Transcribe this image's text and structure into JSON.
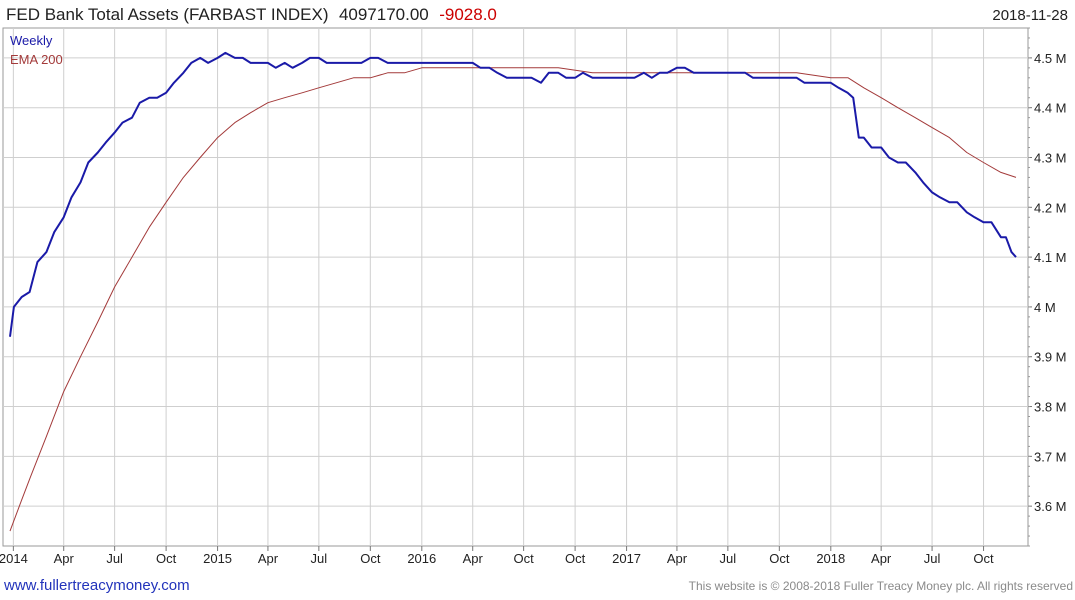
{
  "header": {
    "title": "FED Bank Total Assets (FARBAST INDEX)",
    "last_value": "4097170.00",
    "change": "-9028.0",
    "date": "2018-11-28"
  },
  "legend": {
    "weekly": "Weekly",
    "ema": "EMA 200"
  },
  "footer": {
    "website": "www.fullertreacymoney.com",
    "copyright": "This website is © 2008-2018 Fuller Treacy Money plc. All rights reserved"
  },
  "colors": {
    "weekly": "#1a1aa8",
    "ema": "#a33a3a",
    "grid": "#cfcfcf",
    "change": "#cc0000"
  },
  "chart_data": {
    "type": "line",
    "title": "FED Bank Total Assets (FARBAST INDEX)",
    "xlabel": "",
    "ylabel": "",
    "x_range": [
      "2013-12-26",
      "2018-11-28"
    ],
    "ylim": [
      3.52,
      4.56
    ],
    "y_unit": "M",
    "y_axis_side": "right",
    "grid": true,
    "legend_position": "top-left",
    "y_ticks": [
      {
        "value": 3.6,
        "label": "3.6 M"
      },
      {
        "value": 3.7,
        "label": "3.7 M"
      },
      {
        "value": 3.8,
        "label": "3.8 M"
      },
      {
        "value": 3.9,
        "label": "3.9 M"
      },
      {
        "value": 4.0,
        "label": "4 M"
      },
      {
        "value": 4.1,
        "label": "4.1 M"
      },
      {
        "value": 4.2,
        "label": "4.2 M"
      },
      {
        "value": 4.3,
        "label": "4.3 M"
      },
      {
        "value": 4.4,
        "label": "4.4 M"
      },
      {
        "value": 4.5,
        "label": "4.5 M"
      }
    ],
    "x_ticks": [
      {
        "date": "2014-01-01",
        "label": "2014"
      },
      {
        "date": "2014-04-01",
        "label": "Apr"
      },
      {
        "date": "2014-07-01",
        "label": "Jul"
      },
      {
        "date": "2014-10-01",
        "label": "Oct"
      },
      {
        "date": "2015-01-01",
        "label": "2015"
      },
      {
        "date": "2015-04-01",
        "label": "Apr"
      },
      {
        "date": "2015-07-01",
        "label": "Jul"
      },
      {
        "date": "2015-10-01",
        "label": "Oct"
      },
      {
        "date": "2016-01-01",
        "label": "2016"
      },
      {
        "date": "2016-04-01",
        "label": "Apr"
      },
      {
        "date": "2016-07-01",
        "label": "Oct"
      },
      {
        "date": "2016-10-01",
        "label": "Oct"
      },
      {
        "date": "2017-01-01",
        "label": "2017"
      },
      {
        "date": "2017-04-01",
        "label": "Apr"
      },
      {
        "date": "2017-07-01",
        "label": "Jul"
      },
      {
        "date": "2017-10-01",
        "label": "Oct"
      },
      {
        "date": "2018-01-01",
        "label": "2018"
      },
      {
        "date": "2018-04-01",
        "label": "Apr"
      },
      {
        "date": "2018-07-01",
        "label": "Jul"
      },
      {
        "date": "2018-10-01",
        "label": "Oct"
      }
    ],
    "series": [
      {
        "name": "Weekly",
        "color": "#1a1aa8",
        "points": [
          [
            "2013-12-26",
            3.94
          ],
          [
            "2014-01-02",
            4.0
          ],
          [
            "2014-01-16",
            4.02
          ],
          [
            "2014-01-30",
            4.03
          ],
          [
            "2014-02-13",
            4.09
          ],
          [
            "2014-03-01",
            4.11
          ],
          [
            "2014-03-15",
            4.15
          ],
          [
            "2014-04-01",
            4.18
          ],
          [
            "2014-04-15",
            4.22
          ],
          [
            "2014-05-01",
            4.25
          ],
          [
            "2014-05-15",
            4.29
          ],
          [
            "2014-06-01",
            4.31
          ],
          [
            "2014-06-15",
            4.33
          ],
          [
            "2014-07-01",
            4.35
          ],
          [
            "2014-07-15",
            4.37
          ],
          [
            "2014-08-01",
            4.38
          ],
          [
            "2014-08-15",
            4.41
          ],
          [
            "2014-09-01",
            4.42
          ],
          [
            "2014-09-15",
            4.42
          ],
          [
            "2014-10-01",
            4.43
          ],
          [
            "2014-10-15",
            4.45
          ],
          [
            "2014-11-01",
            4.47
          ],
          [
            "2014-11-15",
            4.49
          ],
          [
            "2014-12-01",
            4.5
          ],
          [
            "2014-12-15",
            4.49
          ],
          [
            "2015-01-01",
            4.5
          ],
          [
            "2015-01-15",
            4.51
          ],
          [
            "2015-02-01",
            4.5
          ],
          [
            "2015-02-15",
            4.5
          ],
          [
            "2015-03-01",
            4.49
          ],
          [
            "2015-03-15",
            4.49
          ],
          [
            "2015-04-01",
            4.49
          ],
          [
            "2015-04-15",
            4.48
          ],
          [
            "2015-05-01",
            4.49
          ],
          [
            "2015-05-15",
            4.48
          ],
          [
            "2015-06-01",
            4.49
          ],
          [
            "2015-06-15",
            4.5
          ],
          [
            "2015-07-01",
            4.5
          ],
          [
            "2015-07-15",
            4.49
          ],
          [
            "2015-08-01",
            4.49
          ],
          [
            "2015-08-15",
            4.49
          ],
          [
            "2015-09-01",
            4.49
          ],
          [
            "2015-09-15",
            4.49
          ],
          [
            "2015-10-01",
            4.5
          ],
          [
            "2015-10-15",
            4.5
          ],
          [
            "2015-11-01",
            4.49
          ],
          [
            "2015-11-15",
            4.49
          ],
          [
            "2015-12-01",
            4.49
          ],
          [
            "2015-12-15",
            4.49
          ],
          [
            "2016-01-01",
            4.49
          ],
          [
            "2016-01-15",
            4.49
          ],
          [
            "2016-02-01",
            4.49
          ],
          [
            "2016-02-15",
            4.49
          ],
          [
            "2016-03-01",
            4.49
          ],
          [
            "2016-03-15",
            4.49
          ],
          [
            "2016-04-01",
            4.49
          ],
          [
            "2016-04-15",
            4.48
          ],
          [
            "2016-05-01",
            4.48
          ],
          [
            "2016-05-15",
            4.47
          ],
          [
            "2016-06-01",
            4.46
          ],
          [
            "2016-06-15",
            4.46
          ],
          [
            "2016-07-01",
            4.46
          ],
          [
            "2016-07-15",
            4.46
          ],
          [
            "2016-08-01",
            4.45
          ],
          [
            "2016-08-15",
            4.47
          ],
          [
            "2016-09-01",
            4.47
          ],
          [
            "2016-09-15",
            4.46
          ],
          [
            "2016-10-01",
            4.46
          ],
          [
            "2016-10-15",
            4.47
          ],
          [
            "2016-11-01",
            4.46
          ],
          [
            "2016-11-15",
            4.46
          ],
          [
            "2016-12-01",
            4.46
          ],
          [
            "2016-12-15",
            4.46
          ],
          [
            "2017-01-01",
            4.46
          ],
          [
            "2017-01-15",
            4.46
          ],
          [
            "2017-02-01",
            4.47
          ],
          [
            "2017-02-15",
            4.46
          ],
          [
            "2017-03-01",
            4.47
          ],
          [
            "2017-03-15",
            4.47
          ],
          [
            "2017-04-01",
            4.48
          ],
          [
            "2017-04-15",
            4.48
          ],
          [
            "2017-05-01",
            4.47
          ],
          [
            "2017-05-15",
            4.47
          ],
          [
            "2017-06-01",
            4.47
          ],
          [
            "2017-06-15",
            4.47
          ],
          [
            "2017-07-01",
            4.47
          ],
          [
            "2017-07-15",
            4.47
          ],
          [
            "2017-08-01",
            4.47
          ],
          [
            "2017-08-15",
            4.46
          ],
          [
            "2017-09-01",
            4.46
          ],
          [
            "2017-09-15",
            4.46
          ],
          [
            "2017-10-01",
            4.46
          ],
          [
            "2017-10-15",
            4.46
          ],
          [
            "2017-11-01",
            4.46
          ],
          [
            "2017-11-15",
            4.45
          ],
          [
            "2017-12-01",
            4.45
          ],
          [
            "2017-12-15",
            4.45
          ],
          [
            "2018-01-01",
            4.45
          ],
          [
            "2018-01-15",
            4.44
          ],
          [
            "2018-01-31",
            4.43
          ],
          [
            "2018-02-10",
            4.42
          ],
          [
            "2018-02-20",
            4.34
          ],
          [
            "2018-03-01",
            4.34
          ],
          [
            "2018-03-15",
            4.32
          ],
          [
            "2018-04-01",
            4.32
          ],
          [
            "2018-04-15",
            4.3
          ],
          [
            "2018-05-01",
            4.29
          ],
          [
            "2018-05-15",
            4.29
          ],
          [
            "2018-06-01",
            4.27
          ],
          [
            "2018-06-15",
            4.25
          ],
          [
            "2018-07-01",
            4.23
          ],
          [
            "2018-07-15",
            4.22
          ],
          [
            "2018-08-01",
            4.21
          ],
          [
            "2018-08-15",
            4.21
          ],
          [
            "2018-09-01",
            4.19
          ],
          [
            "2018-09-15",
            4.18
          ],
          [
            "2018-10-01",
            4.17
          ],
          [
            "2018-10-15",
            4.17
          ],
          [
            "2018-11-01",
            4.14
          ],
          [
            "2018-11-10",
            4.14
          ],
          [
            "2018-11-20",
            4.11
          ],
          [
            "2018-11-28",
            4.1
          ]
        ]
      },
      {
        "name": "EMA 200",
        "color": "#a33a3a",
        "points": [
          [
            "2013-12-26",
            3.55
          ],
          [
            "2014-01-15",
            3.61
          ],
          [
            "2014-02-01",
            3.66
          ],
          [
            "2014-03-01",
            3.74
          ],
          [
            "2014-04-01",
            3.83
          ],
          [
            "2014-05-01",
            3.9
          ],
          [
            "2014-06-01",
            3.97
          ],
          [
            "2014-07-01",
            4.04
          ],
          [
            "2014-08-01",
            4.1
          ],
          [
            "2014-09-01",
            4.16
          ],
          [
            "2014-10-01",
            4.21
          ],
          [
            "2014-11-01",
            4.26
          ],
          [
            "2014-12-01",
            4.3
          ],
          [
            "2015-01-01",
            4.34
          ],
          [
            "2015-02-01",
            4.37
          ],
          [
            "2015-03-01",
            4.39
          ],
          [
            "2015-04-01",
            4.41
          ],
          [
            "2015-05-01",
            4.42
          ],
          [
            "2015-06-01",
            4.43
          ],
          [
            "2015-07-01",
            4.44
          ],
          [
            "2015-08-01",
            4.45
          ],
          [
            "2015-09-01",
            4.46
          ],
          [
            "2015-10-01",
            4.46
          ],
          [
            "2015-11-01",
            4.47
          ],
          [
            "2015-12-01",
            4.47
          ],
          [
            "2016-01-01",
            4.48
          ],
          [
            "2016-03-01",
            4.48
          ],
          [
            "2016-05-01",
            4.48
          ],
          [
            "2016-07-01",
            4.48
          ],
          [
            "2016-09-01",
            4.48
          ],
          [
            "2016-11-01",
            4.47
          ],
          [
            "2017-01-01",
            4.47
          ],
          [
            "2017-03-01",
            4.47
          ],
          [
            "2017-05-01",
            4.47
          ],
          [
            "2017-07-01",
            4.47
          ],
          [
            "2017-09-01",
            4.47
          ],
          [
            "2017-11-01",
            4.47
          ],
          [
            "2018-01-01",
            4.46
          ],
          [
            "2018-02-01",
            4.46
          ],
          [
            "2018-03-01",
            4.44
          ],
          [
            "2018-04-01",
            4.42
          ],
          [
            "2018-05-01",
            4.4
          ],
          [
            "2018-06-01",
            4.38
          ],
          [
            "2018-07-01",
            4.36
          ],
          [
            "2018-08-01",
            4.34
          ],
          [
            "2018-09-01",
            4.31
          ],
          [
            "2018-10-01",
            4.29
          ],
          [
            "2018-11-01",
            4.27
          ],
          [
            "2018-11-28",
            4.26
          ]
        ]
      }
    ]
  }
}
